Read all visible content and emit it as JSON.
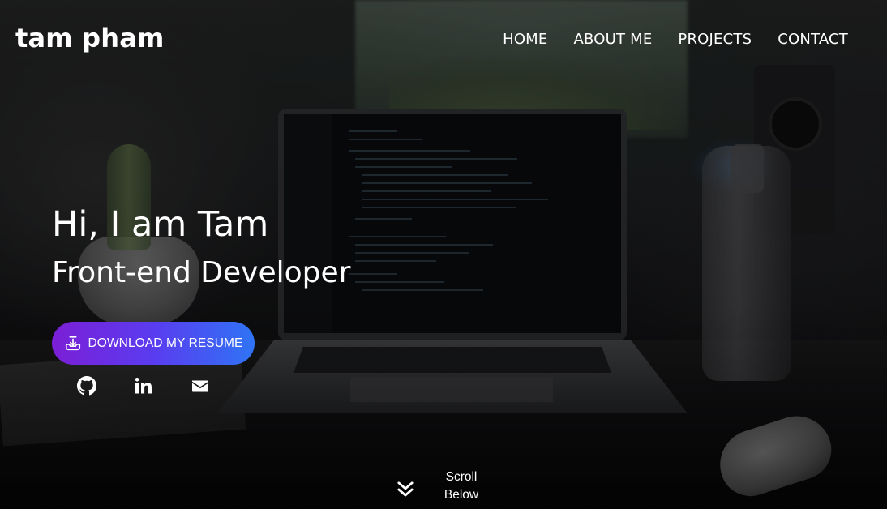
{
  "header": {
    "brand": "tam pham",
    "nav": [
      {
        "label": "HOME"
      },
      {
        "label": "ABOUT ME"
      },
      {
        "label": "PROJECTS"
      },
      {
        "label": "CONTACT"
      }
    ]
  },
  "hero": {
    "greeting": "Hi, I am Tam",
    "role": "Front-end Developer",
    "resume_button": {
      "label": "DOWNLOAD MY RESUME",
      "icon": "download-icon"
    },
    "socials": [
      {
        "icon": "github-icon"
      },
      {
        "icon": "linkedin-icon"
      },
      {
        "icon": "envelope-icon"
      }
    ]
  },
  "scroll_hint": {
    "line1": "Scroll",
    "line2": "Below",
    "icon": "double-chevron-down-icon"
  },
  "colors": {
    "button_gradient_start": "#7b1fd6",
    "button_gradient_end": "#2f74f5",
    "text": "#ffffff",
    "background": "#0b0b0d"
  }
}
